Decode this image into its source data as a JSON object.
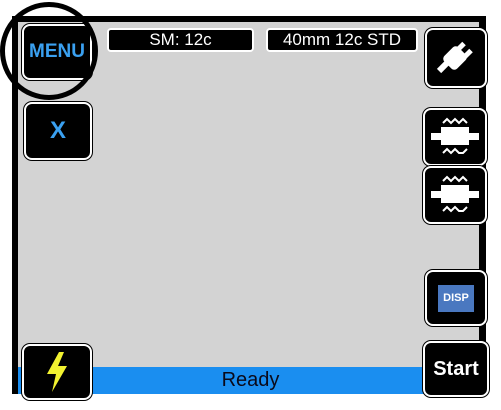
{
  "header": {
    "menu_label": "MENU",
    "fiber_type": "SM: 12c",
    "program": "40mm 12c STD"
  },
  "buttons": {
    "cancel_label": "X",
    "start_label": "Start",
    "disp_label": "DISP"
  },
  "status": {
    "text": "Ready"
  },
  "colors": {
    "accent_blue": "#3aa0f0",
    "status_bar": "#1a8ef0",
    "screen_bg": "#d3d3d3",
    "lightning": "#f2f230"
  },
  "icons": {
    "power": "plug-icon",
    "heater1": "heater-icon",
    "heater2": "heater-icon",
    "arc": "lightning-icon"
  }
}
